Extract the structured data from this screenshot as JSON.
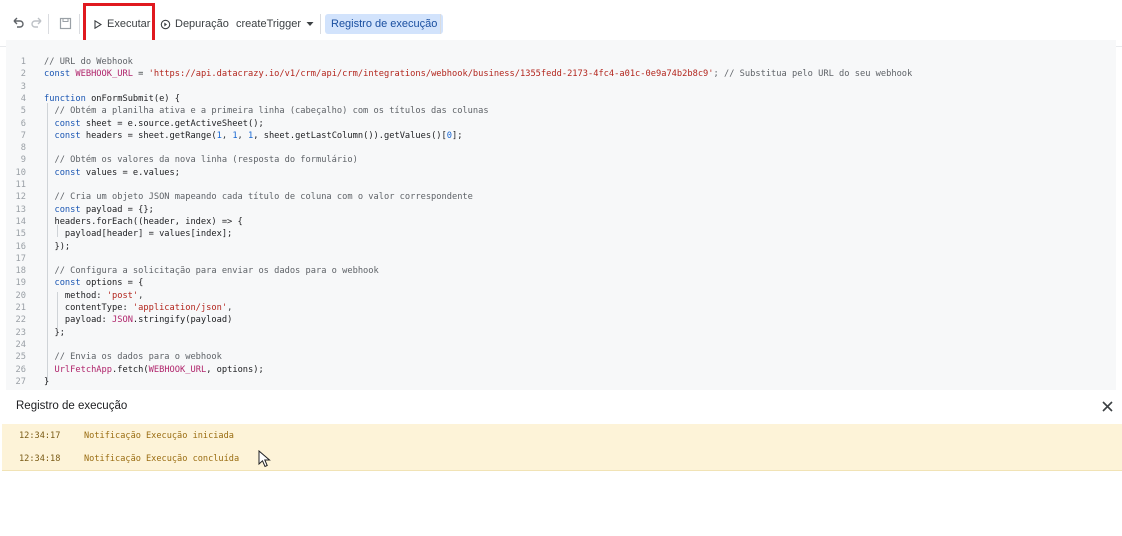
{
  "toolbar": {
    "undo_icon": "undo-icon",
    "redo_icon": "redo-icon",
    "save_icon": "save-icon",
    "run_label": "Executar",
    "debug_label": "Depuração",
    "function_select": "createTrigger",
    "exec_log_label": "Registro de execução"
  },
  "editor": {
    "lines": [
      {
        "n": "1",
        "parts": [
          {
            "t": "// URL do Webhook",
            "c": "c-com"
          }
        ]
      },
      {
        "n": "2",
        "parts": [
          {
            "t": "const ",
            "c": "c-kw"
          },
          {
            "t": "WEBHOOK_URL",
            "c": "c-cls"
          },
          {
            "t": " = ",
            "c": ""
          },
          {
            "t": "'https://api.datacrazy.io/v1/crm/api/crm/integrations/webhook/business/1355fedd-2173-4fc4-a01c-0e9a74b2b8c9'",
            "c": "c-str"
          },
          {
            "t": "; // Substitua pelo URL do seu webhook",
            "c": "c-com"
          }
        ]
      },
      {
        "n": "3",
        "parts": []
      },
      {
        "n": "4",
        "parts": [
          {
            "t": "function ",
            "c": "c-kw"
          },
          {
            "t": "onFormSubmit(e) {",
            "c": "c-fn"
          }
        ]
      },
      {
        "n": "5",
        "parts": [
          {
            "t": "  // Obtém a planilha ativa e a primeira linha (cabeçalho) com os títulos das colunas",
            "c": "c-com"
          }
        ]
      },
      {
        "n": "6",
        "parts": [
          {
            "t": "  const ",
            "c": "c-kw"
          },
          {
            "t": "sheet = e.source.getActiveSheet();",
            "c": "c-fn"
          }
        ]
      },
      {
        "n": "7",
        "parts": [
          {
            "t": "  const ",
            "c": "c-kw"
          },
          {
            "t": "headers = sheet.getRange(",
            "c": "c-fn"
          },
          {
            "t": "1",
            "c": "c-num"
          },
          {
            "t": ", ",
            "c": ""
          },
          {
            "t": "1",
            "c": "c-num"
          },
          {
            "t": ", ",
            "c": ""
          },
          {
            "t": "1",
            "c": "c-num"
          },
          {
            "t": ", sheet.getLastColumn()).getValues()[",
            "c": "c-fn"
          },
          {
            "t": "0",
            "c": "c-num"
          },
          {
            "t": "];",
            "c": "c-fn"
          }
        ]
      },
      {
        "n": "8",
        "parts": []
      },
      {
        "n": "9",
        "parts": [
          {
            "t": "  // Obtém os valores da nova linha (resposta do formulário)",
            "c": "c-com"
          }
        ]
      },
      {
        "n": "10",
        "parts": [
          {
            "t": "  const ",
            "c": "c-kw"
          },
          {
            "t": "values = e.values;",
            "c": "c-fn"
          }
        ]
      },
      {
        "n": "11",
        "parts": []
      },
      {
        "n": "12",
        "parts": [
          {
            "t": "  // Cria um objeto JSON mapeando cada título de coluna com o valor correspondente",
            "c": "c-com"
          }
        ]
      },
      {
        "n": "13",
        "parts": [
          {
            "t": "  const ",
            "c": "c-kw"
          },
          {
            "t": "payload = {};",
            "c": "c-fn"
          }
        ]
      },
      {
        "n": "14",
        "parts": [
          {
            "t": "  headers.forEach((header, index) => {",
            "c": "c-fn"
          }
        ]
      },
      {
        "n": "15",
        "parts": [
          {
            "t": "    payload[header] = values[index];",
            "c": "c-fn"
          }
        ]
      },
      {
        "n": "16",
        "parts": [
          {
            "t": "  });",
            "c": "c-fn"
          }
        ]
      },
      {
        "n": "17",
        "parts": []
      },
      {
        "n": "18",
        "parts": [
          {
            "t": "  // Configura a solicitação para enviar os dados para o webhook",
            "c": "c-com"
          }
        ]
      },
      {
        "n": "19",
        "parts": [
          {
            "t": "  const ",
            "c": "c-kw"
          },
          {
            "t": "options = {",
            "c": "c-fn"
          }
        ]
      },
      {
        "n": "20",
        "parts": [
          {
            "t": "    method: ",
            "c": "c-fn"
          },
          {
            "t": "'post'",
            "c": "c-str"
          },
          {
            "t": ",",
            "c": ""
          }
        ]
      },
      {
        "n": "21",
        "parts": [
          {
            "t": "    contentType: ",
            "c": "c-fn"
          },
          {
            "t": "'application/json'",
            "c": "c-str"
          },
          {
            "t": ",",
            "c": ""
          }
        ]
      },
      {
        "n": "22",
        "parts": [
          {
            "t": "    payload: ",
            "c": "c-fn"
          },
          {
            "t": "JSON",
            "c": "c-cls"
          },
          {
            "t": ".stringify(payload)",
            "c": "c-fn"
          }
        ]
      },
      {
        "n": "23",
        "parts": [
          {
            "t": "  };",
            "c": "c-fn"
          }
        ]
      },
      {
        "n": "24",
        "parts": []
      },
      {
        "n": "25",
        "parts": [
          {
            "t": "  // Envia os dados para o webhook",
            "c": "c-com"
          }
        ]
      },
      {
        "n": "26",
        "parts": [
          {
            "t": "  ",
            "c": ""
          },
          {
            "t": "UrlFetchApp",
            "c": "c-cls"
          },
          {
            "t": ".fetch(",
            "c": "c-fn"
          },
          {
            "t": "WEBHOOK_URL",
            "c": "c-cls"
          },
          {
            "t": ", options);",
            "c": "c-fn"
          }
        ]
      },
      {
        "n": "27",
        "parts": [
          {
            "t": "}",
            "c": "c-fn"
          }
        ]
      }
    ]
  },
  "log_panel": {
    "title": "Registro de execução",
    "close_icon": "close-icon",
    "rows": [
      {
        "time": "12:34:17",
        "level": "Notificação",
        "message": "Execução iniciada"
      },
      {
        "time": "12:34:18",
        "level": "Notificação",
        "message": "Execução concluída"
      }
    ]
  },
  "colors": {
    "run_highlight": "#e0191f",
    "exec_log_button_bg": "#d2e3fc",
    "log_row_bg": "#fdf3d8",
    "editor_bg": "#f7f8f9"
  }
}
